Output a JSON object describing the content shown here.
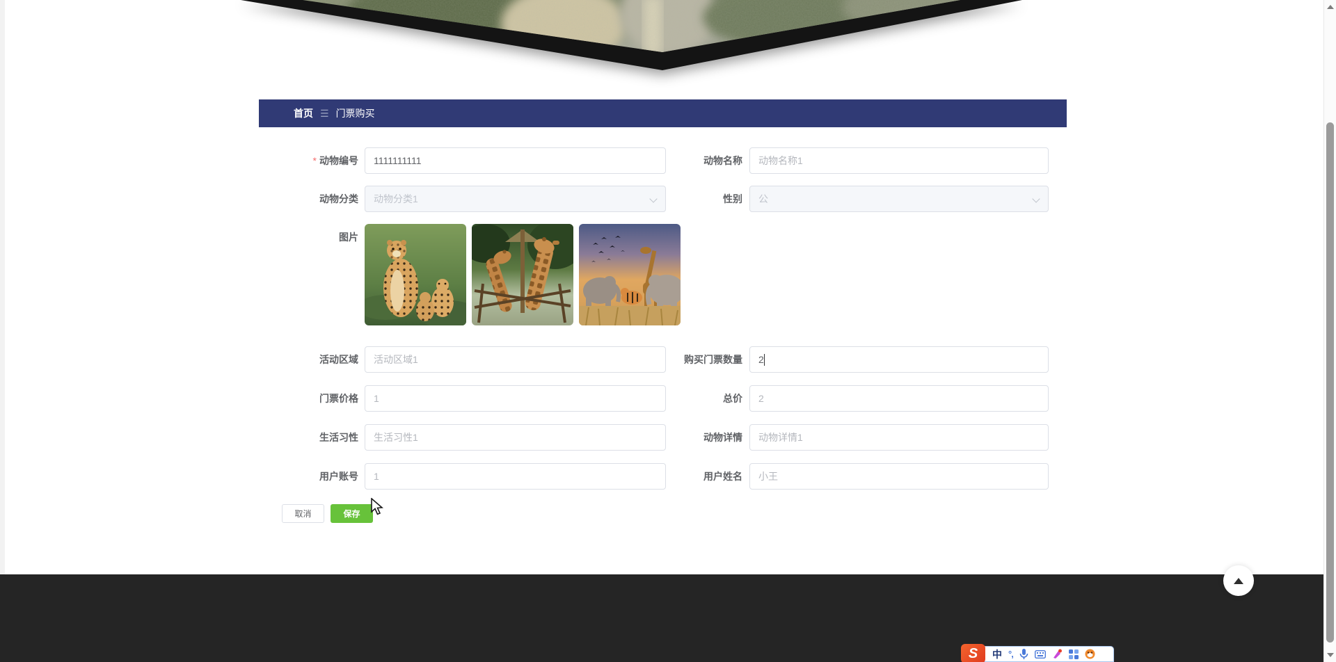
{
  "breadcrumb": {
    "home": "首页",
    "separator": "☰",
    "current": "门票购买"
  },
  "form": {
    "required_mark": "*",
    "fields": {
      "animal_no": {
        "label": "动物编号",
        "value": "1111111111"
      },
      "animal_name": {
        "label": "动物名称",
        "value": "动物名称1"
      },
      "category": {
        "label": "动物分类",
        "value": "动物分类1"
      },
      "gender": {
        "label": "性别",
        "value": "公"
      },
      "images": {
        "label": "图片",
        "items": [
          "cheetah-photo",
          "giraffe-photo",
          "savanna-photo"
        ]
      },
      "area": {
        "label": "活动区域",
        "value": "活动区域1"
      },
      "quantity": {
        "label": "购买门票数量",
        "value": "2"
      },
      "price": {
        "label": "门票价格",
        "value": "1"
      },
      "total": {
        "label": "总价",
        "value": "2"
      },
      "habits": {
        "label": "生活习性",
        "value": "生活习性1"
      },
      "details": {
        "label": "动物详情",
        "value": "动物详情1"
      },
      "account": {
        "label": "用户账号",
        "value": "1"
      },
      "username": {
        "label": "用户姓名",
        "value": "小王"
      }
    }
  },
  "buttons": {
    "cancel": "取消",
    "save": "保存"
  },
  "colors": {
    "breadcrumb_bg": "#303a75",
    "save_green": "#67c23a",
    "footer_bg": "#252525",
    "required_red": "#f56c6c",
    "disabled_bg": "#f5f7fa"
  },
  "ime": {
    "lang_mode": "中",
    "punct": "°,"
  }
}
